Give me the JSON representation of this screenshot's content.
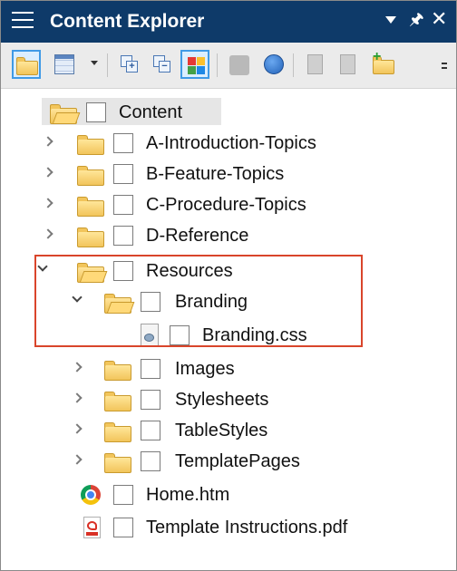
{
  "panel": {
    "title": "Content Explorer",
    "icons": {
      "menu": "hamburger-menu-icon",
      "dropdown": "caret-down-icon",
      "pin": "pin-icon",
      "close": "close-icon"
    }
  },
  "toolbar": {
    "buttons": [
      {
        "icon": "folder-icon",
        "selected": true
      },
      {
        "icon": "grid-view-icon",
        "selected": false
      },
      {
        "icon": "expand-all-icon",
        "selected": false
      },
      {
        "icon": "collapse-all-icon",
        "selected": false
      },
      {
        "icon": "color-grid-icon",
        "selected": true
      },
      {
        "icon": "gear-icon",
        "disabled": true
      },
      {
        "icon": "refresh-globe-icon",
        "selected": false
      },
      {
        "icon": "document-icon",
        "disabled": true
      },
      {
        "icon": "search-document-icon",
        "disabled": true
      },
      {
        "icon": "new-folder-icon",
        "selected": false
      }
    ]
  },
  "tree": {
    "items": [
      {
        "label": "Content",
        "type": "folder-open",
        "depth": 0
      },
      {
        "label": "A-Introduction-Topics",
        "type": "folder",
        "depth": 1,
        "expanded": false
      },
      {
        "label": "B-Feature-Topics",
        "type": "folder",
        "depth": 1,
        "expanded": false
      },
      {
        "label": "C-Procedure-Topics",
        "type": "folder",
        "depth": 1,
        "expanded": false
      },
      {
        "label": "D-Reference",
        "type": "folder",
        "depth": 1,
        "expanded": false
      },
      {
        "label": "Resources",
        "type": "folder-open",
        "depth": 1,
        "expanded": true
      },
      {
        "label": "Branding",
        "type": "folder-open",
        "depth": 2,
        "expanded": true
      },
      {
        "label": "Branding.css",
        "type": "css-file",
        "depth": 3
      },
      {
        "label": "Images",
        "type": "folder",
        "depth": 2,
        "expanded": false
      },
      {
        "label": "Stylesheets",
        "type": "folder",
        "depth": 2,
        "expanded": false
      },
      {
        "label": "TableStyles",
        "type": "folder",
        "depth": 2,
        "expanded": false
      },
      {
        "label": "TemplatePages",
        "type": "folder",
        "depth": 2,
        "expanded": false
      },
      {
        "label": "Home.htm",
        "type": "chrome-file",
        "depth": 1
      },
      {
        "label": "Template Instructions.pdf",
        "type": "pdf-file",
        "depth": 1
      }
    ]
  },
  "colors": {
    "titlebar": "#0e3a69",
    "highlight_box": "#d9452b",
    "selection_border": "#3f9ae6"
  }
}
